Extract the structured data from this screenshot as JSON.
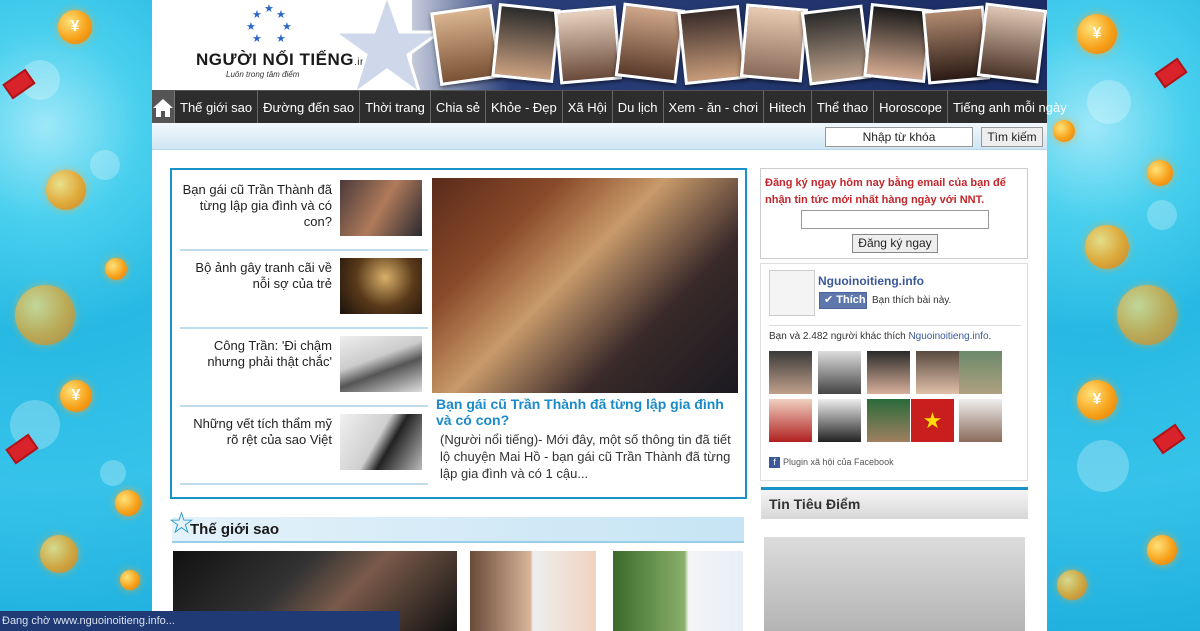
{
  "logo": {
    "name": "NGƯỜI NỔI TIẾNG",
    "suffix": ".info",
    "tagline": "Luôn trong tâm điểm"
  },
  "nav": {
    "home_icon": "home-icon",
    "items": [
      "Thế giới sao",
      "Đường đến sao",
      "Thời trang",
      "Chia sẻ",
      "Khỏe - Đẹp",
      "Xã Hội",
      "Du lịch",
      "Xem - ăn - chơi",
      "Hitech",
      "Thể thao",
      "Horoscope",
      "Tiếng anh mỗi ngày"
    ]
  },
  "search": {
    "placeholder": "Nhập từ khóa",
    "button": "Tìm kiếm"
  },
  "featured": {
    "side_items": [
      "Bạn gái cũ Trần Thành đã từng lập gia đình và có con?",
      "Bộ ảnh gây tranh cãi về nỗi sợ của trẻ",
      "Công Trần: 'Đi chậm nhưng phải thật chắc'",
      "Những vết tích thẩm mỹ rõ rệt của sao Việt"
    ],
    "main_title": "Bạn gái cũ Trần Thành đã từng lập gia đình và có con?",
    "main_desc": "(Người nổi tiếng)- Mới đây, một số thông tin đã tiết lộ chuyện Mai Hồ - bạn gái cũ Trần Thành đã từng lập gia đình và có 1 cậu..."
  },
  "signup": {
    "text": "Đăng ký ngay hôm nay bằng email của bạn để nhận tin tức mới nhất hàng ngày với NNT.",
    "button": "Đăng ký ngay"
  },
  "facebook": {
    "page_name": "Nguoinoitieng.info",
    "like_button": "Thích",
    "like_text": "Bạn thích bài này.",
    "count_prefix": "Bạn và 2.482 người khác thích ",
    "count_link": "Nguoinoitieng.info",
    "count_suffix": ".",
    "plugin": "Plugin xã hội của Facebook"
  },
  "sidebar": {
    "tin_tieu_diem": "Tin Tiêu Điểm"
  },
  "section": {
    "title": "Thế giới sao"
  },
  "status": {
    "text": "Đang chờ www.nguoinoitieng.info..."
  },
  "colors": {
    "accent": "#1a91c9",
    "nav_bg": "#2d2d2d",
    "title_blue": "#1a8ac8",
    "signup_red": "#c3262a",
    "fb_blue": "#3b5998"
  }
}
